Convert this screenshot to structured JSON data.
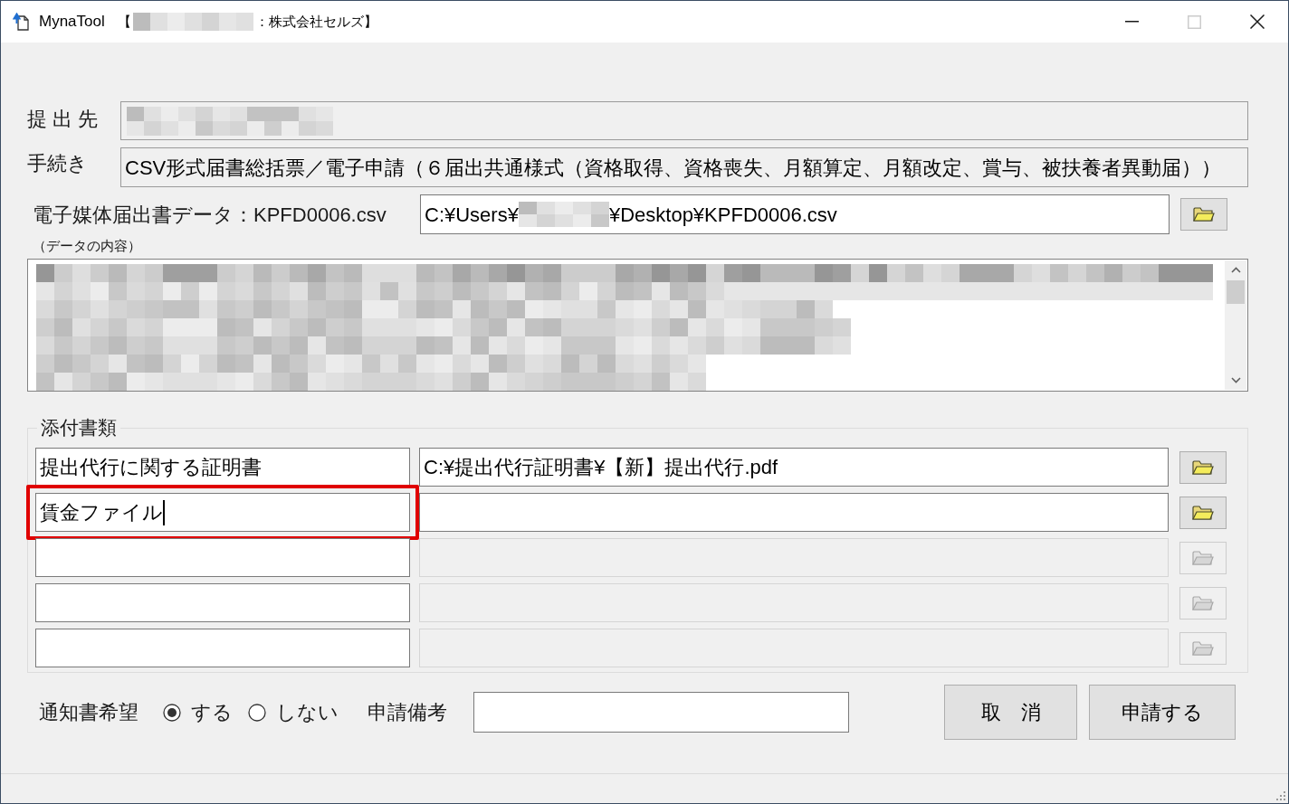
{
  "window": {
    "app_name": "MynaTool",
    "title_prefix": "【",
    "title_suffix": "：株式会社セルズ】",
    "controls": [
      {
        "kind": "minimize",
        "disabled": false
      },
      {
        "kind": "maximize",
        "disabled": true
      },
      {
        "kind": "close",
        "disabled": false
      }
    ]
  },
  "submit_to": {
    "label": "提 出 先"
  },
  "procedure": {
    "label": "手続き",
    "value": "CSV形式届書総括票／電子申請（６届出共通様式（資格取得、資格喪失、月額算定、月額改定、賞与、被扶養者異動届））"
  },
  "data_file": {
    "label": "電子媒体届出書データ：KPFD0006.csv",
    "path_start": "C:¥Users¥",
    "path_end": "¥Desktop¥KPFD0006.csv"
  },
  "data_content": {
    "label": "（データの内容）"
  },
  "attachments": {
    "legend": "添付書類",
    "rows": [
      {
        "name": "提出代行に関する証明書",
        "path": "C:¥提出代行証明書¥【新】提出代行.pdf",
        "disabled": false,
        "focused": false,
        "highlighted": false
      },
      {
        "name": "賃金ファイル",
        "disabled": false,
        "focused": true,
        "highlighted": true
      },
      {
        "disabled": true,
        "focused": false,
        "highlighted": false
      },
      {
        "disabled": true,
        "focused": false,
        "highlighted": false
      },
      {
        "disabled": true,
        "focused": false,
        "highlighted": false
      }
    ]
  },
  "notify": {
    "label": "通知書希望",
    "options": [
      {
        "label": "する",
        "selected": true
      },
      {
        "label": "しない",
        "selected": false
      }
    ]
  },
  "remarks": {
    "label": "申請備考"
  },
  "buttons": [
    {
      "label": "取　消"
    },
    {
      "label": "申請する"
    }
  ]
}
